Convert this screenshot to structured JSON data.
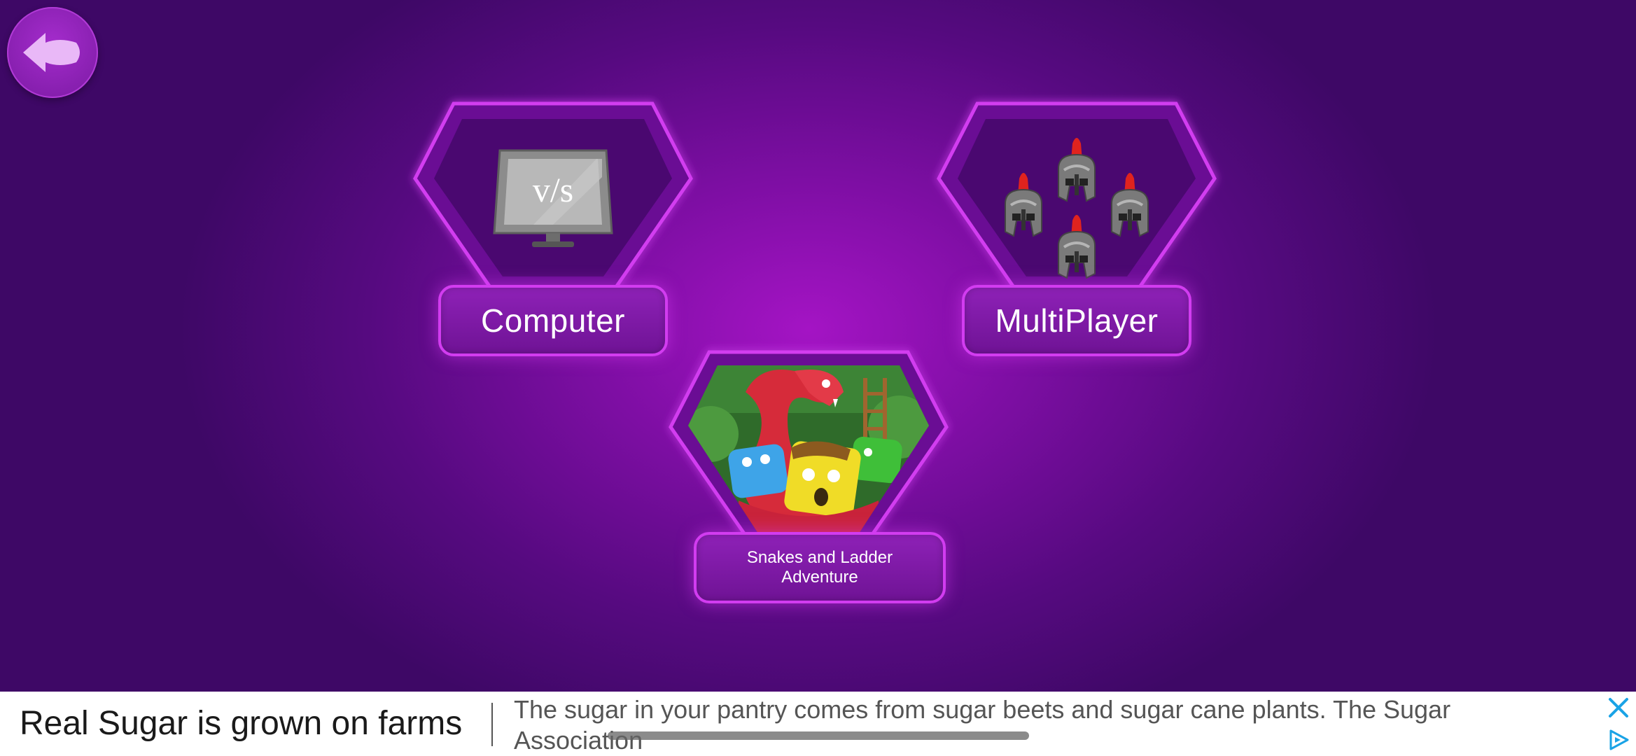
{
  "back_button": {
    "icon": "back-arrow-icon"
  },
  "modes": [
    {
      "id": "computer",
      "label": "Computer",
      "icon": "vs-monitor-icon",
      "icon_text": "v/s"
    },
    {
      "id": "multiplayer",
      "label": "MultiPlayer",
      "icon": "spartan-helmets-icon"
    },
    {
      "id": "snakes",
      "label": "Snakes and Ladder Adventure",
      "icon": "snake-and-blocks-illustration"
    }
  ],
  "ad": {
    "headline": "Real Sugar is grown on farms",
    "body": "The sugar in your pantry comes from sugar beets and sugar cane plants. The Sugar Association",
    "close_icon": "close-icon",
    "adchoices_icon": "adchoices-icon"
  },
  "colors": {
    "accent": "#d23cf0",
    "card_fill": "#5a0a80",
    "ad_close": "#1aa3e6"
  }
}
